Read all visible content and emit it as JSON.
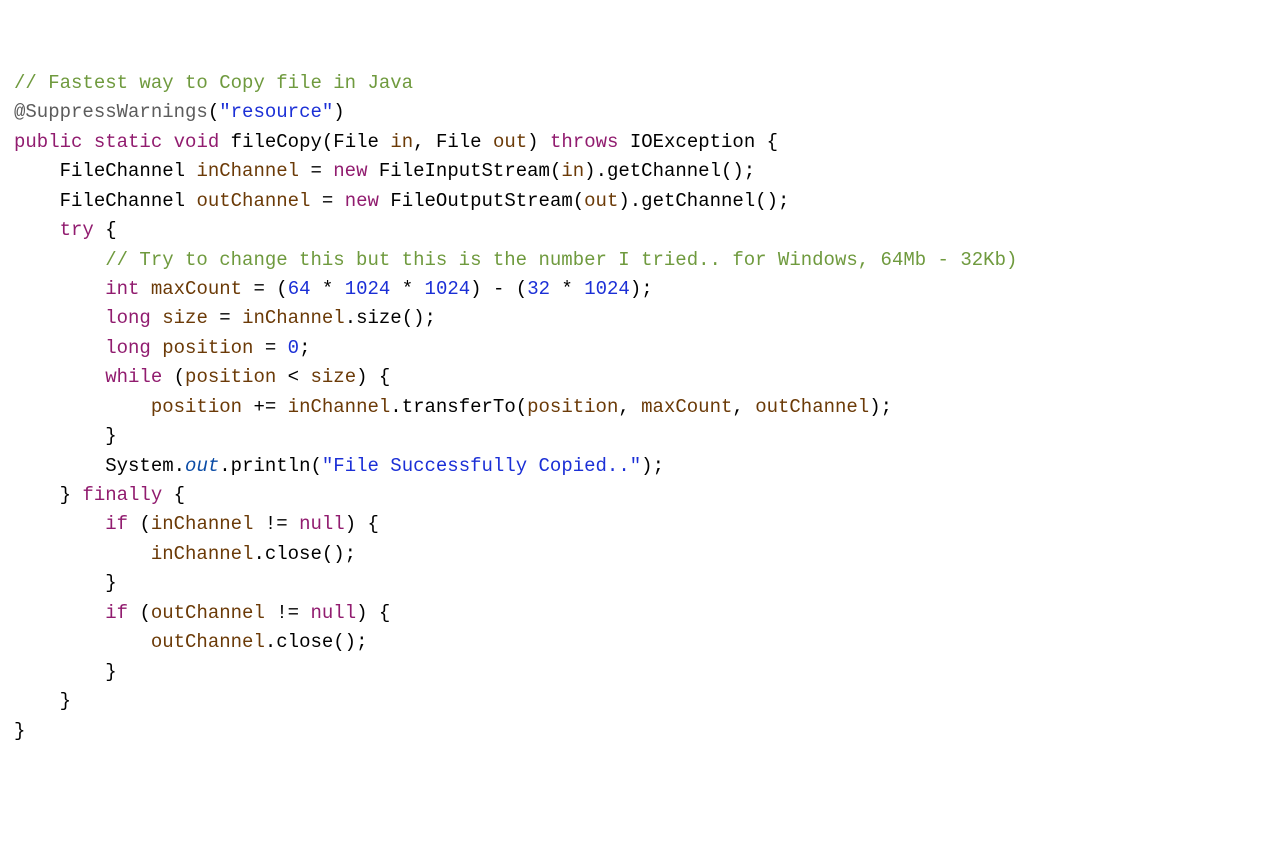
{
  "code": {
    "c1": "// Fastest way to Copy file in Java",
    "annot": "@SuppressWarnings",
    "annotArg": "\"resource\"",
    "kw_public": "public",
    "kw_static": "static",
    "kw_void": "void",
    "fn_name": "fileCopy",
    "type_File": "File",
    "param_in": "in",
    "param_out": "out",
    "kw_throws": "throws",
    "type_IOException": "IOException",
    "lbrace": "{",
    "rbrace": "}",
    "type_FileChannel": "FileChannel",
    "var_inChannel": "inChannel",
    "eq": "=",
    "kw_new": "new",
    "type_FileInputStream": "FileInputStream",
    "type_FileOutputStream": "FileOutputStream",
    "m_getChannel": ".getChannel()",
    "semi": ";",
    "var_outChannel": "outChannel",
    "kw_try": "try",
    "c2": "// Try to change this but this is the number I tried.. for Windows, 64Mb - 32Kb)",
    "kw_int": "int",
    "var_maxCount": "maxCount",
    "expr_max_open": "(",
    "num_64": "64",
    "star": "*",
    "num_1024a": "1024",
    "num_1024b": "1024",
    "expr_max_mid": ") - (",
    "num_32": "32",
    "num_1024c": "1024",
    "expr_max_close": ")",
    "kw_long": "long",
    "var_size": "size",
    "m_size": ".size()",
    "var_position": "position",
    "num_0": "0",
    "kw_while": "while",
    "lt": "<",
    "pluseq": "+=",
    "m_transferTo": ".transferTo(",
    "comma": ",",
    "close_paren": ")",
    "sys": "System",
    "out_field": "out",
    "m_println": ".println(",
    "str_success": "\"File Successfully Copied..\"",
    "kw_finally": "finally",
    "kw_if": "if",
    "neq": "!=",
    "kw_null": "null",
    "m_close": ".close()"
  }
}
